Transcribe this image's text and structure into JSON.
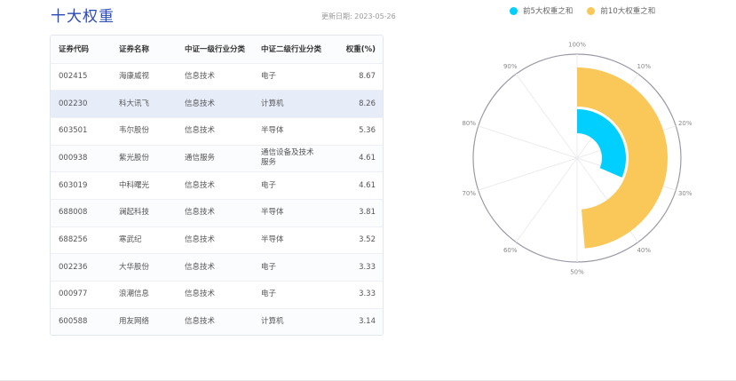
{
  "header": {
    "title": "十大权重",
    "update_date": "更新日期: 2023-05-26"
  },
  "table": {
    "columns": [
      "证券代码",
      "证券名称",
      "中证一级行业分类",
      "中证二级行业分类",
      "权重(%)"
    ],
    "rows": [
      [
        "002415",
        "海康威视",
        "信息技术",
        "电子",
        "8.67"
      ],
      [
        "002230",
        "科大讯飞",
        "信息技术",
        "计算机",
        "8.26"
      ],
      [
        "603501",
        "韦尔股份",
        "信息技术",
        "半导体",
        "5.36"
      ],
      [
        "000938",
        "紫光股份",
        "通信服务",
        "通信设备及技术服务",
        "4.61"
      ],
      [
        "603019",
        "中科曙光",
        "信息技术",
        "电子",
        "4.61"
      ],
      [
        "688008",
        "澜起科技",
        "信息技术",
        "半导体",
        "3.81"
      ],
      [
        "688256",
        "寒武纪",
        "信息技术",
        "半导体",
        "3.52"
      ],
      [
        "002236",
        "大华股份",
        "信息技术",
        "电子",
        "3.33"
      ],
      [
        "000977",
        "浪潮信息",
        "信息技术",
        "电子",
        "3.33"
      ],
      [
        "600588",
        "用友网络",
        "信息技术",
        "计算机",
        "3.14"
      ]
    ]
  },
  "legend": {
    "items": [
      {
        "label": "前5大权重之和",
        "color": "#00cfff"
      },
      {
        "label": "前10大权重之和",
        "color": "#f9c859"
      }
    ]
  },
  "chart_data": {
    "type": "polar-bar",
    "series": [
      {
        "name": "前5大权重之和",
        "value": 31.51,
        "color": "#00cfff"
      },
      {
        "name": "前10大权重之和",
        "value": 48.64,
        "color": "#f9c859"
      }
    ],
    "angle_axis": {
      "min": 0,
      "max": 100,
      "tick_labels": [
        "100%",
        "10%",
        "20%",
        "30%",
        "40%",
        "50%",
        "60%",
        "70%",
        "80%",
        "90%"
      ]
    }
  }
}
